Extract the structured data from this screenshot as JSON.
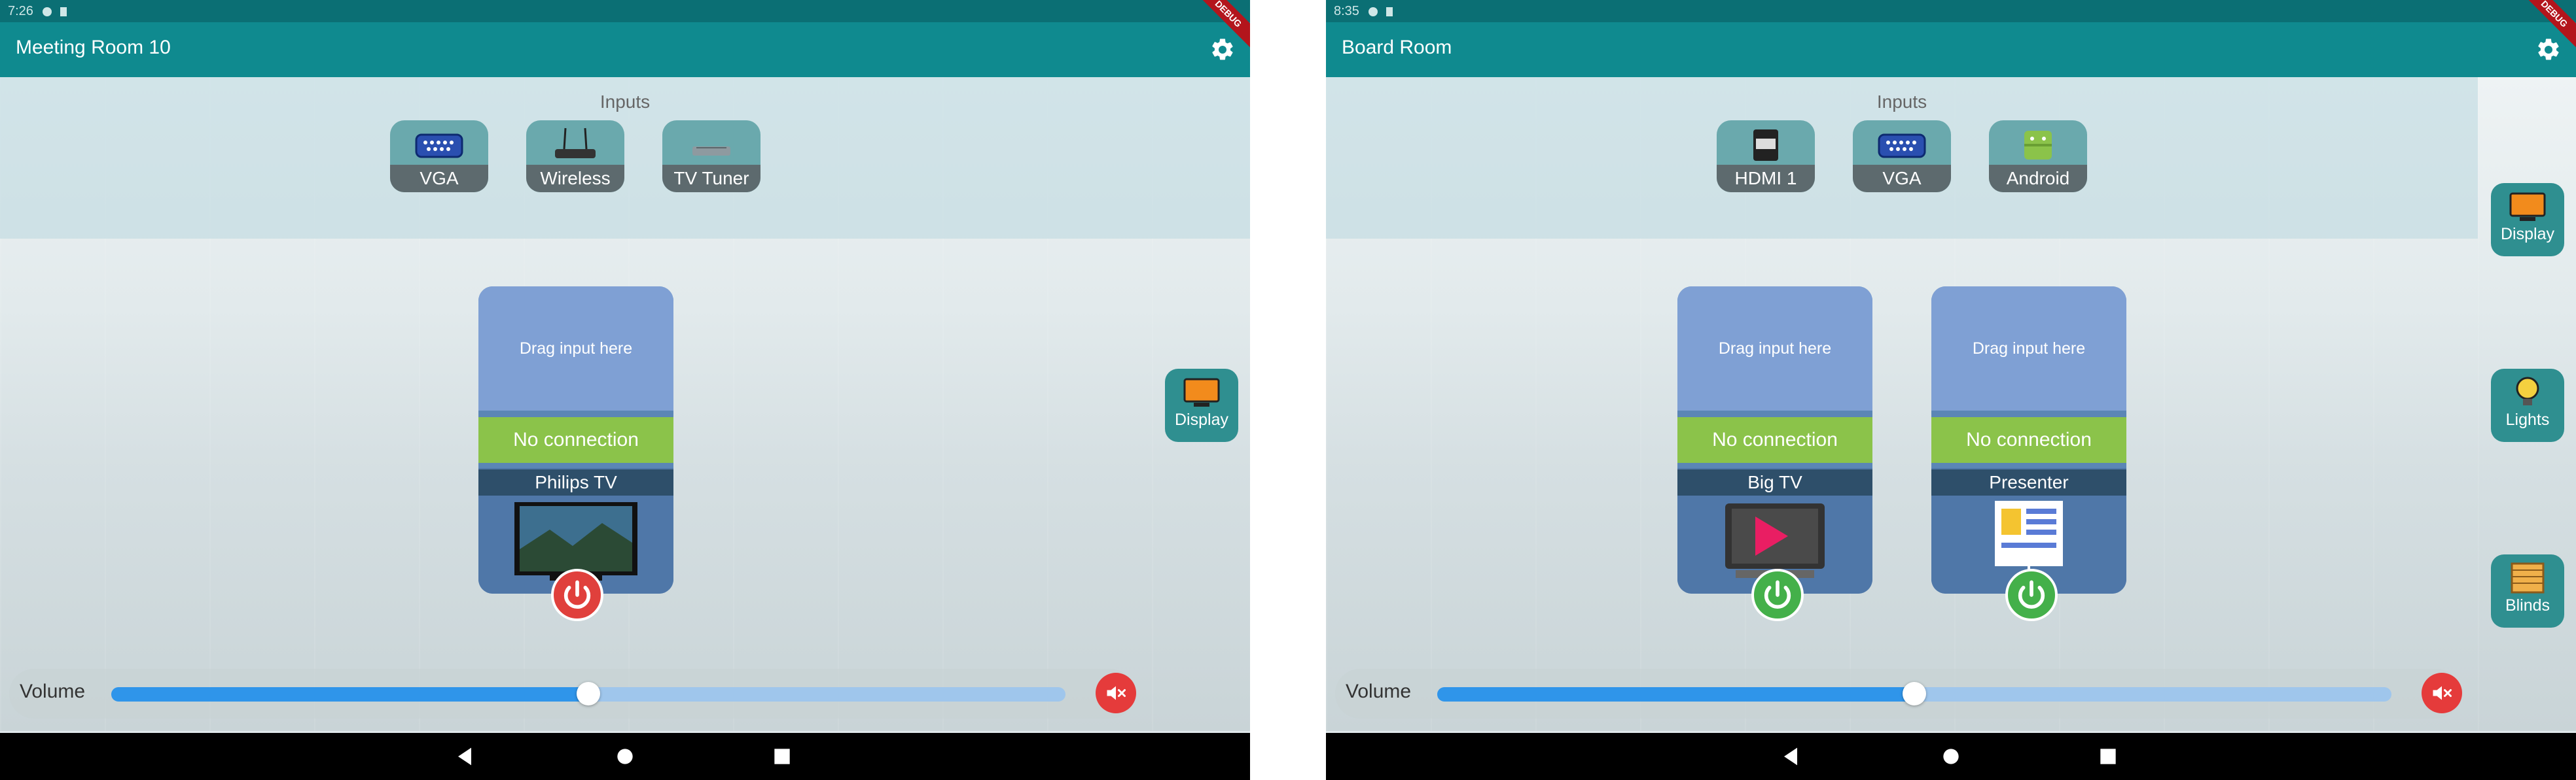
{
  "left": {
    "status_time": "7:26",
    "room_title": "Meeting Room 10",
    "debug_banner": "DEBUG",
    "inputs_label": "Inputs",
    "inputs": [
      {
        "label": "VGA",
        "icon": "vga-icon"
      },
      {
        "label": "Wireless",
        "icon": "wireless-router-icon"
      },
      {
        "label": "TV Tuner",
        "icon": "tv-tuner-icon"
      }
    ],
    "side_buttons": [
      {
        "label": "Display",
        "icon": "display-icon"
      }
    ],
    "zones": [
      {
        "drag_text": "Drag input here",
        "connection": "No connection",
        "output_name": "Philips TV",
        "power": "off"
      }
    ],
    "volume_label": "Volume",
    "volume_level": 0.5
  },
  "right": {
    "status_time": "8:35",
    "room_title": "Board Room",
    "debug_banner": "DEBUG",
    "inputs_label": "Inputs",
    "inputs": [
      {
        "label": "HDMI 1",
        "icon": "hdmi-icon"
      },
      {
        "label": "VGA",
        "icon": "vga-icon"
      },
      {
        "label": "Android",
        "icon": "android-icon"
      }
    ],
    "side_buttons": [
      {
        "label": "Display",
        "icon": "display-icon"
      },
      {
        "label": "Lights",
        "icon": "lightbulb-icon"
      },
      {
        "label": "Blinds",
        "icon": "blinds-icon"
      }
    ],
    "zones": [
      {
        "drag_text": "Drag input here",
        "connection": "No connection",
        "output_name": "Big TV",
        "power": "on"
      },
      {
        "drag_text": "Drag input here",
        "connection": "No connection",
        "output_name": "Presenter",
        "power": "on"
      }
    ],
    "volume_label": "Volume",
    "volume_level": 0.5
  },
  "colors": {
    "appbar": "#0f8a8f",
    "statusbar": "#0b6f74",
    "connection": "#8bc34a",
    "power_off": "#e0403c",
    "power_on": "#44b04a",
    "slider": "#2f95ea",
    "mute": "#e53b3b"
  }
}
